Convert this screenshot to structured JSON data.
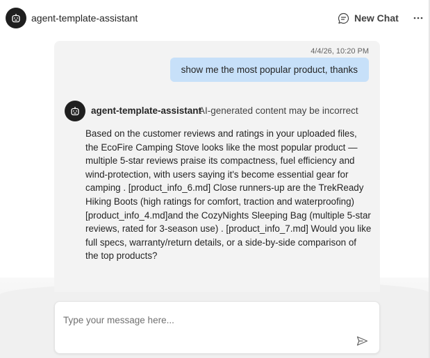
{
  "header": {
    "title": "agent-template-assistant",
    "avatar_icon": "robot-icon",
    "new_chat_label": "New Chat",
    "new_chat_icon": "chat-bubble-icon",
    "more_icon": "more-horizontal-icon"
  },
  "conversation": {
    "user_message": {
      "timestamp": "4/4/26, 10:20 PM",
      "text": "show me the most popular product, thanks"
    },
    "bot_message": {
      "name": "agent-template-assistant",
      "disclaimer": "AI-generated content may be incorrect",
      "text": "Based on the customer reviews and ratings in your uploaded files, the EcoFire Camping Stove looks like the most popular product — multiple 5-star reviews praise its compactness, fuel efficiency and wind-protection, with users saying it's become essential gear for camping . [product_info_6.md] Close runners-up are the TrekReady Hiking Boots (high ratings for comfort, traction and waterproofing) [product_info_4.md]and the CozyNights Sleeping Bag (multiple 5-star reviews, rated for 3-season use) . [product_info_7.md] Would you like full specs, warranty/return details, or a side-by-side comparison of the top products?"
    }
  },
  "composer": {
    "placeholder": "Type your message here...",
    "value": "",
    "send_icon": "send-icon"
  },
  "colors": {
    "user_bubble": "#c7e0f9",
    "panel_bg": "#f3f3f3",
    "avatar_bg": "#1f1f1f"
  }
}
